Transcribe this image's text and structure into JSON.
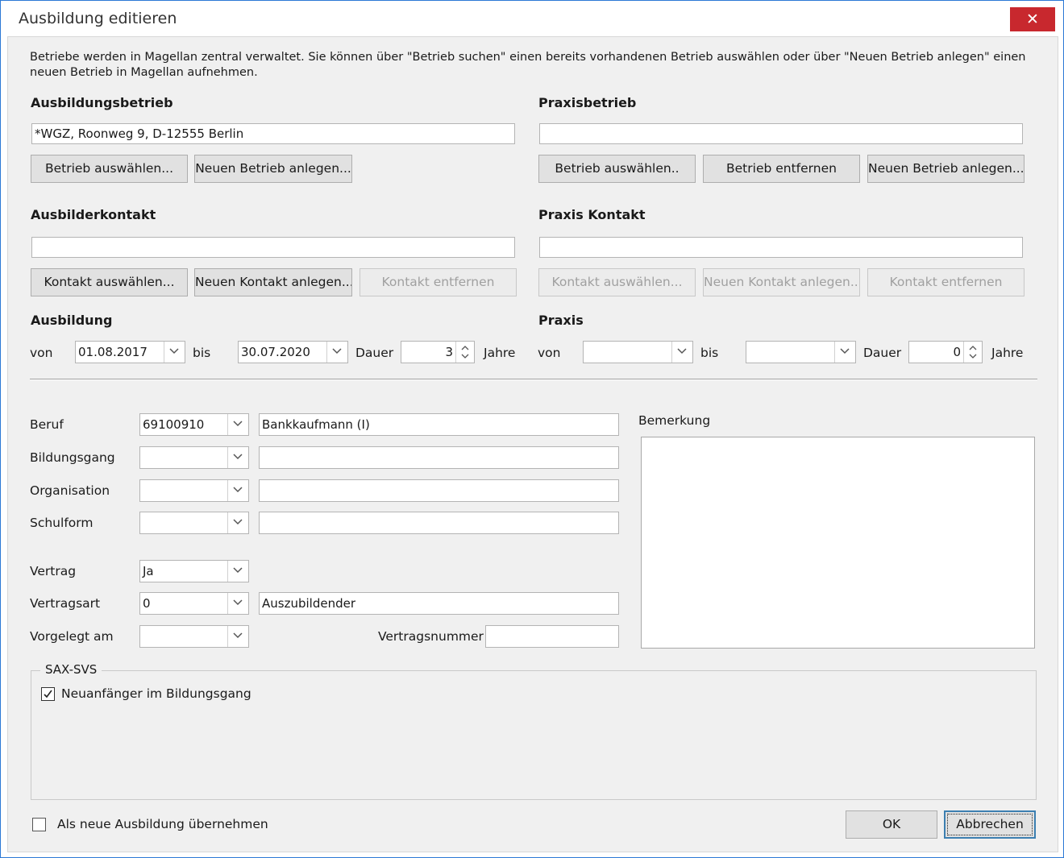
{
  "window": {
    "title": "Ausbildung editieren",
    "close_glyph": "✕"
  },
  "info_text": "Betriebe werden in Magellan zentral verwaltet. Sie können über \"Betrieb suchen\" einen bereits vorhandenen Betrieb auswählen oder über \"Neuen Betrieb anlegen\" einen neuen Betrieb in Magellan aufnehmen.",
  "ausbildungsbetrieb": {
    "heading": "Ausbildungsbetrieb",
    "value": "*WGZ, Roonweg 9, D-12555 Berlin",
    "btn_select": "Betrieb auswählen...",
    "btn_new": "Neuen Betrieb anlegen..."
  },
  "praxisbetrieb": {
    "heading": "Praxisbetrieb",
    "value": "",
    "btn_select": "Betrieb auswählen..",
    "btn_remove": "Betrieb entfernen",
    "btn_new": "Neuen Betrieb anlegen..."
  },
  "ausbilderkontakt": {
    "heading": "Ausbilderkontakt",
    "value": "",
    "btn_select": "Kontakt auswählen...",
    "btn_new": "Neuen Kontakt anlegen...",
    "btn_remove": "Kontakt entfernen"
  },
  "praxiskontakt": {
    "heading": "Praxis Kontakt",
    "value": "",
    "btn_select": "Kontakt auswählen...",
    "btn_new": "Neuen Kontakt anlegen...",
    "btn_remove": "Kontakt entfernen"
  },
  "ausbildung": {
    "heading": "Ausbildung",
    "von_label": "von",
    "von_value": "01.08.2017",
    "bis_label": "bis",
    "bis_value": "30.07.2020",
    "dauer_label": "Dauer",
    "dauer_value": "3",
    "jahre_label": "Jahre"
  },
  "praxis": {
    "heading": "Praxis",
    "von_label": "von",
    "von_value": "",
    "bis_label": "bis",
    "bis_value": "",
    "dauer_label": "Dauer",
    "dauer_value": "0",
    "jahre_label": "Jahre"
  },
  "form": {
    "beruf": {
      "label": "Beruf",
      "code": "69100910",
      "text": "Bankkaufmann (I)"
    },
    "bildungsgang": {
      "label": "Bildungsgang",
      "code": "",
      "text": ""
    },
    "organisation": {
      "label": "Organisation",
      "code": "",
      "text": ""
    },
    "schulform": {
      "label": "Schulform",
      "code": "",
      "text": ""
    },
    "vertrag": {
      "label": "Vertrag",
      "value": "Ja"
    },
    "vertragsart": {
      "label": "Vertragsart",
      "code": "0",
      "text": "Auszubildender"
    },
    "vorgelegt": {
      "label": "Vorgelegt am",
      "value": ""
    },
    "vertragsnummer": {
      "label": "Vertragsnummer",
      "value": ""
    },
    "bemerkung": {
      "label": "Bemerkung",
      "value": ""
    }
  },
  "sax_svs": {
    "legend": "SAX-SVS",
    "neuanfaenger_label": "Neuanfänger im Bildungsgang",
    "neuanfaenger_checked": true
  },
  "footer": {
    "uebernehmen_label": "Als neue Ausbildung übernehmen",
    "uebernehmen_checked": false,
    "ok_label": "OK",
    "cancel_label": "Abbrechen"
  }
}
